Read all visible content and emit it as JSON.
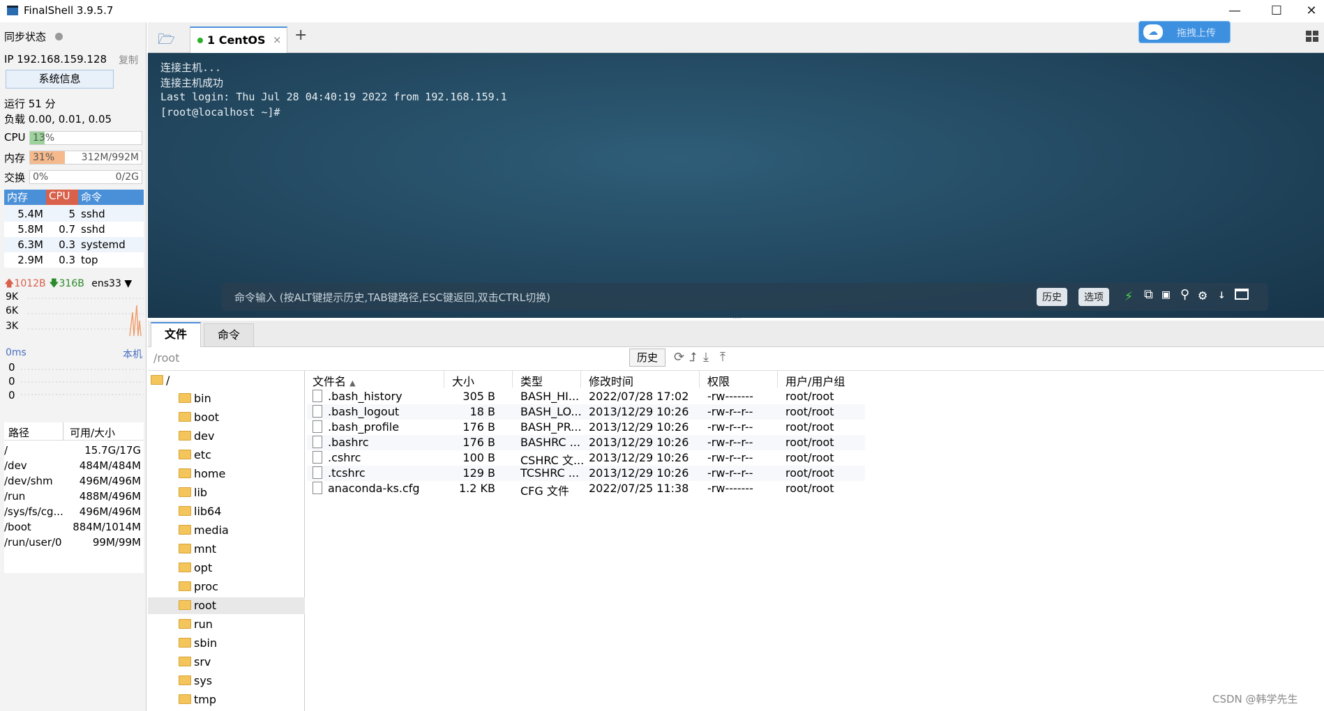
{
  "window": {
    "title": "FinalShell 3.9.5.7",
    "min": "—",
    "max": "☐",
    "close": "✕"
  },
  "left": {
    "sync_label": "同步状态",
    "ip": "IP 192.168.159.128",
    "copy": "复制",
    "sysinfo_btn": "系统信息",
    "uptime": "运行 51 分",
    "load": "负载 0.00, 0.01, 0.05",
    "cpu": {
      "label": "CPU",
      "text": "13%",
      "fraction": 0.13
    },
    "mem": {
      "label": "内存",
      "text": "31%",
      "right": "312M/992M",
      "fraction": 0.31
    },
    "swap": {
      "label": "交换",
      "text": "0%",
      "right": "0/2G",
      "fraction": 0.0
    },
    "proc_headers": [
      "内存",
      "CPU",
      "命令"
    ],
    "processes": [
      {
        "mem": "5.4M",
        "cpu": "5",
        "cmd": "sshd"
      },
      {
        "mem": "5.8M",
        "cpu": "0.7",
        "cmd": "sshd"
      },
      {
        "mem": "6.3M",
        "cpu": "0.3",
        "cmd": "systemd"
      },
      {
        "mem": "2.9M",
        "cpu": "0.3",
        "cmd": "top"
      }
    ],
    "net": {
      "up": "1012B",
      "down": "316B",
      "iface": "ens33",
      "ticks": [
        "9K",
        "6K",
        "3K"
      ]
    },
    "ping": {
      "label": "0ms",
      "host": "本机",
      "values": [
        "0",
        "0",
        "0"
      ]
    },
    "disk_headers": [
      "路径",
      "可用/大小"
    ],
    "disks": [
      {
        "path": "/",
        "size": "15.7G/17G"
      },
      {
        "path": "/dev",
        "size": "484M/484M"
      },
      {
        "path": "/dev/shm",
        "size": "496M/496M"
      },
      {
        "path": "/run",
        "size": "488M/496M"
      },
      {
        "path": "/sys/fs/cg...",
        "size": "496M/496M"
      },
      {
        "path": "/boot",
        "size": "884M/1014M"
      },
      {
        "path": "/run/user/0",
        "size": "99M/99M"
      }
    ]
  },
  "tabs": {
    "session_tab": "1  CentOS",
    "close": "×",
    "add": "+",
    "upload": "拖拽上传"
  },
  "terminal": {
    "lines": [
      "连接主机...",
      "连接主机成功",
      "Last login: Thu Jul 28 04:40:19 2022 from 192.168.159.1",
      "[root@localhost ~]#"
    ],
    "cmd_placeholder": "命令输入 (按ALT键提示历史,TAB键路径,ESC键返回,双击CTRL切换)",
    "history_btn": "历史",
    "options_btn": "选项"
  },
  "lower": {
    "tabs": [
      "文件",
      "命令"
    ],
    "path": "/root",
    "history_btn": "历史",
    "tree": [
      "/",
      "bin",
      "boot",
      "dev",
      "etc",
      "home",
      "lib",
      "lib64",
      "media",
      "mnt",
      "opt",
      "proc",
      "root",
      "run",
      "sbin",
      "srv",
      "sys",
      "tmp"
    ],
    "columns": [
      "文件名",
      "大小",
      "类型",
      "修改时间",
      "权限",
      "用户/用户组"
    ],
    "files": [
      {
        "name": ".bash_history",
        "size": "305 B",
        "type": "BASH_HI...",
        "mtime": "2022/07/28 17:02",
        "perm": "-rw-------",
        "owner": "root/root"
      },
      {
        "name": ".bash_logout",
        "size": "18 B",
        "type": "BASH_LO...",
        "mtime": "2013/12/29 10:26",
        "perm": "-rw-r--r--",
        "owner": "root/root"
      },
      {
        "name": ".bash_profile",
        "size": "176 B",
        "type": "BASH_PR...",
        "mtime": "2013/12/29 10:26",
        "perm": "-rw-r--r--",
        "owner": "root/root"
      },
      {
        "name": ".bashrc",
        "size": "176 B",
        "type": "BASHRC ...",
        "mtime": "2013/12/29 10:26",
        "perm": "-rw-r--r--",
        "owner": "root/root"
      },
      {
        "name": ".cshrc",
        "size": "100 B",
        "type": "CSHRC 文...",
        "mtime": "2013/12/29 10:26",
        "perm": "-rw-r--r--",
        "owner": "root/root"
      },
      {
        "name": ".tcshrc",
        "size": "129 B",
        "type": "TCSHRC ...",
        "mtime": "2013/12/29 10:26",
        "perm": "-rw-r--r--",
        "owner": "root/root"
      },
      {
        "name": "anaconda-ks.cfg",
        "size": "1.2 KB",
        "type": "CFG 文件",
        "mtime": "2022/07/25 11:38",
        "perm": "-rw-------",
        "owner": "root/root"
      }
    ]
  },
  "watermark": "CSDN @韩学先生",
  "colors": {
    "accent": "#4a90d9",
    "cpu_fill": "#9bd39b",
    "mem_fill": "#f5b98c",
    "proc_mem": "#4a90d9",
    "proc_cpu": "#d9604a",
    "terminal_bg": "#244b63"
  }
}
